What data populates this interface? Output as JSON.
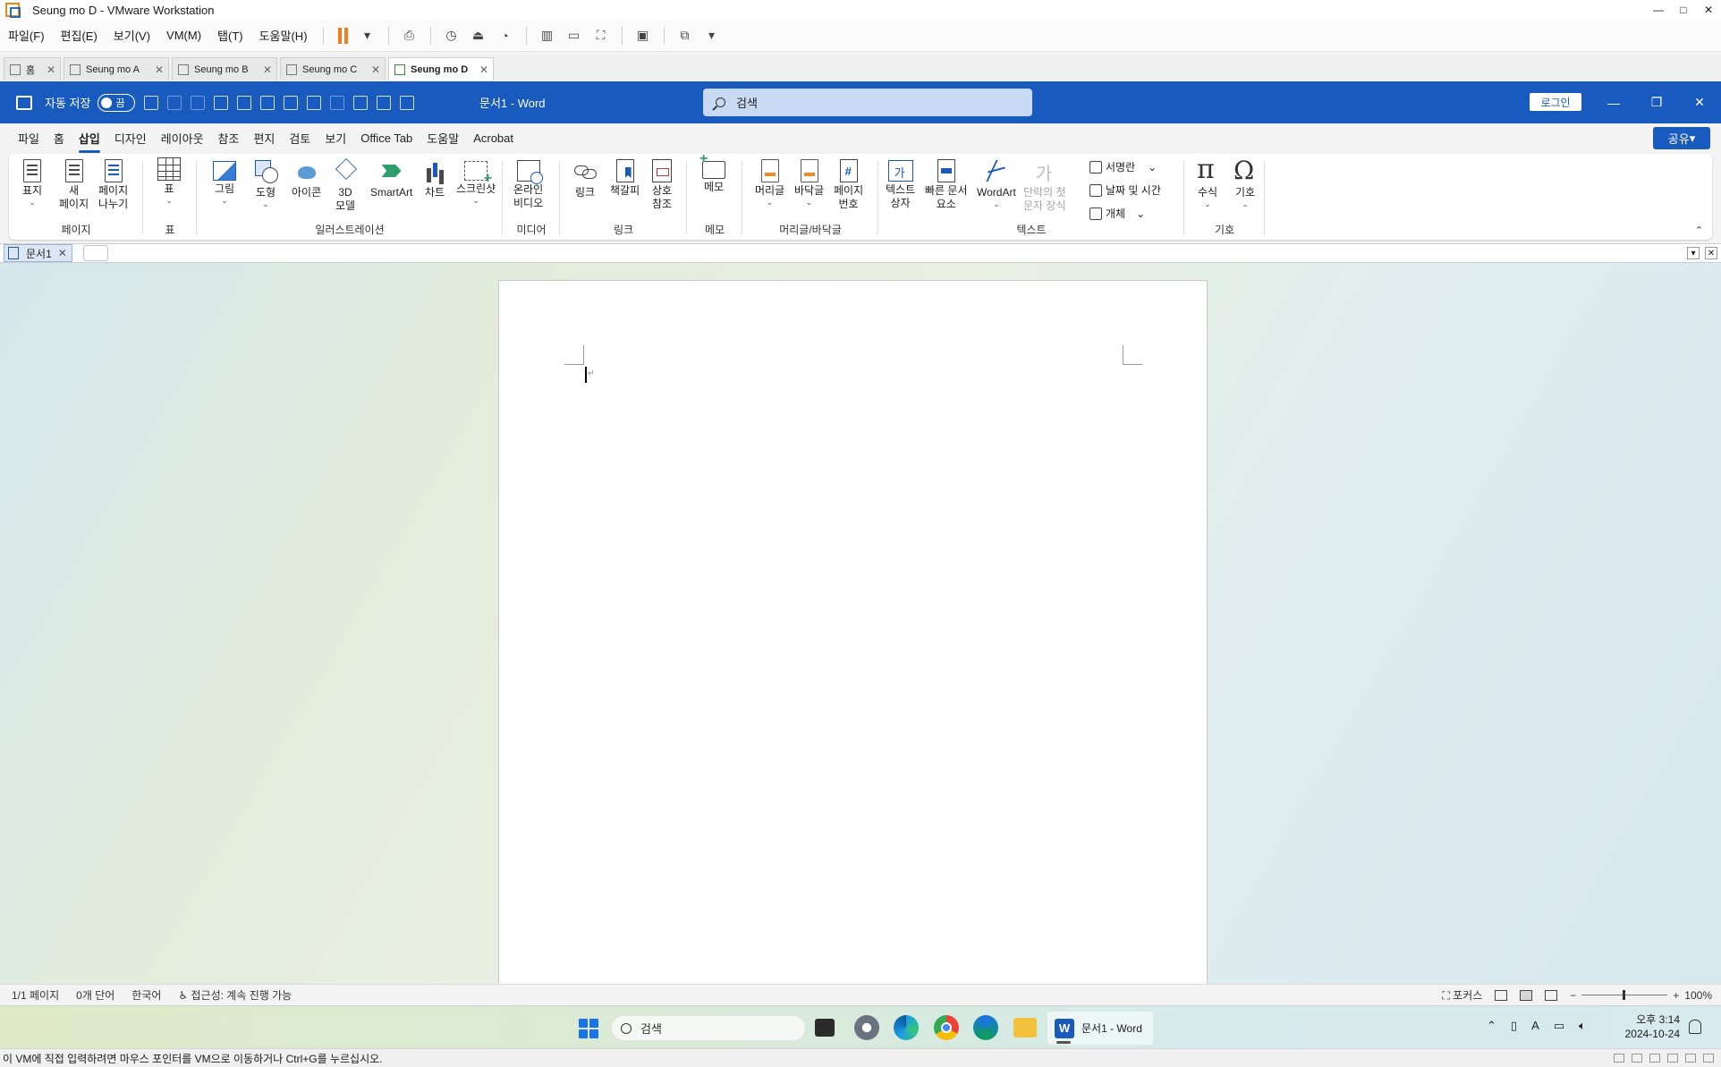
{
  "vmware": {
    "window_title": "Seung mo D - VMware Workstation",
    "menu": [
      "파일(F)",
      "편집(E)",
      "보기(V)",
      "VM(M)",
      "탭(T)",
      "도움말(H)"
    ],
    "tabs": [
      {
        "label": "홈",
        "active": false
      },
      {
        "label": "Seung mo A",
        "active": false
      },
      {
        "label": "Seung mo B",
        "active": false
      },
      {
        "label": "Seung mo C",
        "active": false
      },
      {
        "label": "Seung mo D",
        "active": true
      }
    ],
    "hint": "이 VM에 직접 입력하려면 마우스 포인터를 VM으로 이동하거나 Ctrl+G를 누르십시오."
  },
  "word": {
    "autosave_label": "자동 저장",
    "autosave_state": "끔",
    "doc_title": "문서1 - Word",
    "search_placeholder": "검색",
    "login_label": "로그인",
    "share_label": "공유",
    "ribbon_tabs": [
      "파일",
      "홈",
      "삽입",
      "디자인",
      "레이아웃",
      "참조",
      "편지",
      "검토",
      "보기",
      "Office Tab",
      "도움말",
      "Acrobat"
    ],
    "active_tab": "삽입",
    "groups": {
      "page": {
        "label": "페이지",
        "buttons": [
          "표지",
          "새\n페이지",
          "페이지\n나누기"
        ]
      },
      "table": {
        "label": "표",
        "buttons": [
          "표"
        ]
      },
      "illustrations": {
        "label": "일러스트레이션",
        "buttons": [
          "그림",
          "도형",
          "아이콘",
          "3D\n모델",
          "SmartArt",
          "차트",
          "스크린샷"
        ]
      },
      "media": {
        "label": "미디어",
        "buttons": [
          "온라인\n비디오"
        ]
      },
      "links": {
        "label": "링크",
        "buttons": [
          "링크",
          "책갈피",
          "상호\n참조"
        ]
      },
      "comments": {
        "label": "메모",
        "buttons": [
          "메모"
        ]
      },
      "header_footer": {
        "label": "머리글/바닥글",
        "buttons": [
          "머리글",
          "바닥글",
          "페이지\n번호"
        ]
      },
      "text": {
        "label": "텍스트",
        "buttons": [
          "텍스트\n상자",
          "빠른 문서\n요소",
          "WordArt",
          "단락의 첫\n문자 장식"
        ],
        "small": [
          "서명란",
          "날짜 및 시간",
          "개체"
        ]
      },
      "symbols": {
        "label": "기호",
        "buttons": [
          "수식",
          "기호"
        ]
      }
    },
    "office_tab": "문서1",
    "status": {
      "page": "1/1 페이지",
      "words": "0개 단어",
      "language": "한국어",
      "accessibility": "접근성: 계속 진행 가능",
      "focus": "포커스",
      "zoom": "100%"
    }
  },
  "taskbar": {
    "search_placeholder": "검색",
    "word_button": "문서1 - Word",
    "time": "오후 3:14",
    "date": "2024-10-24"
  },
  "colors": {
    "word_blue": "#185abd",
    "vm_pause_orange": "#f07d1c"
  }
}
